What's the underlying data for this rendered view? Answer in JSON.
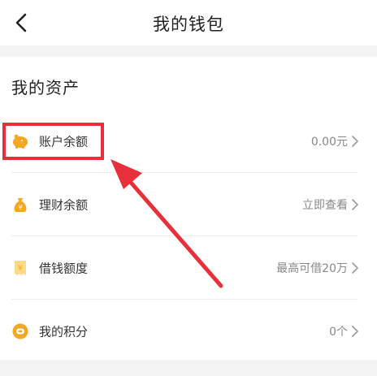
{
  "header": {
    "title": "我的钱包"
  },
  "section": {
    "title": "我的资产"
  },
  "rows": [
    {
      "label": "账户余额",
      "value": "0.00元",
      "icon": "piggy-bank-icon"
    },
    {
      "label": "理财余额",
      "value": "立即查看",
      "icon": "money-bag-icon"
    },
    {
      "label": "借钱额度",
      "value": "最高可借20万",
      "icon": "loan-receipt-icon"
    },
    {
      "label": "我的积分",
      "value": "0个",
      "icon": "points-coin-icon"
    }
  ],
  "colors": {
    "accent": "#f5a623",
    "highlight": "#e8303a"
  }
}
